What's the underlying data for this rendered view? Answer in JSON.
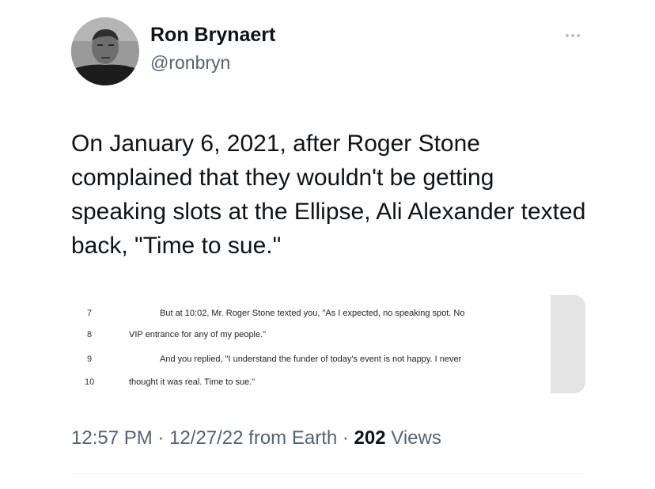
{
  "author": {
    "display_name": "Ron Brynaert",
    "handle": "@ronbryn",
    "avatar_icon": "user-avatar-photo"
  },
  "tweet": {
    "text": "On January 6, 2021, after Roger Stone complained that they wouldn't be getting speaking slots at the Ellipse, Ali Alexander texted back, \"Time to sue.\""
  },
  "media": {
    "transcript_lines": [
      {
        "number": "7",
        "text": "But at 10:02, Mr. Roger Stone texted you, \"As I expected, no speaking spot.   No"
      },
      {
        "number": "8",
        "text": "VIP entrance for any of my people.\""
      },
      {
        "number": "9",
        "text": "And you replied, \"I understand the funder of today's event is not happy.   I never"
      },
      {
        "number": "10",
        "text": "thought it was real.   Time to sue.\""
      }
    ]
  },
  "meta": {
    "time": "12:57 PM",
    "separator": "·",
    "date": "12/27/22",
    "source": "from Earth",
    "views_count": "202",
    "views_label": "Views"
  },
  "colors": {
    "text_primary": "#0f1419",
    "text_secondary": "#536471",
    "divider": "#eff3f4"
  }
}
